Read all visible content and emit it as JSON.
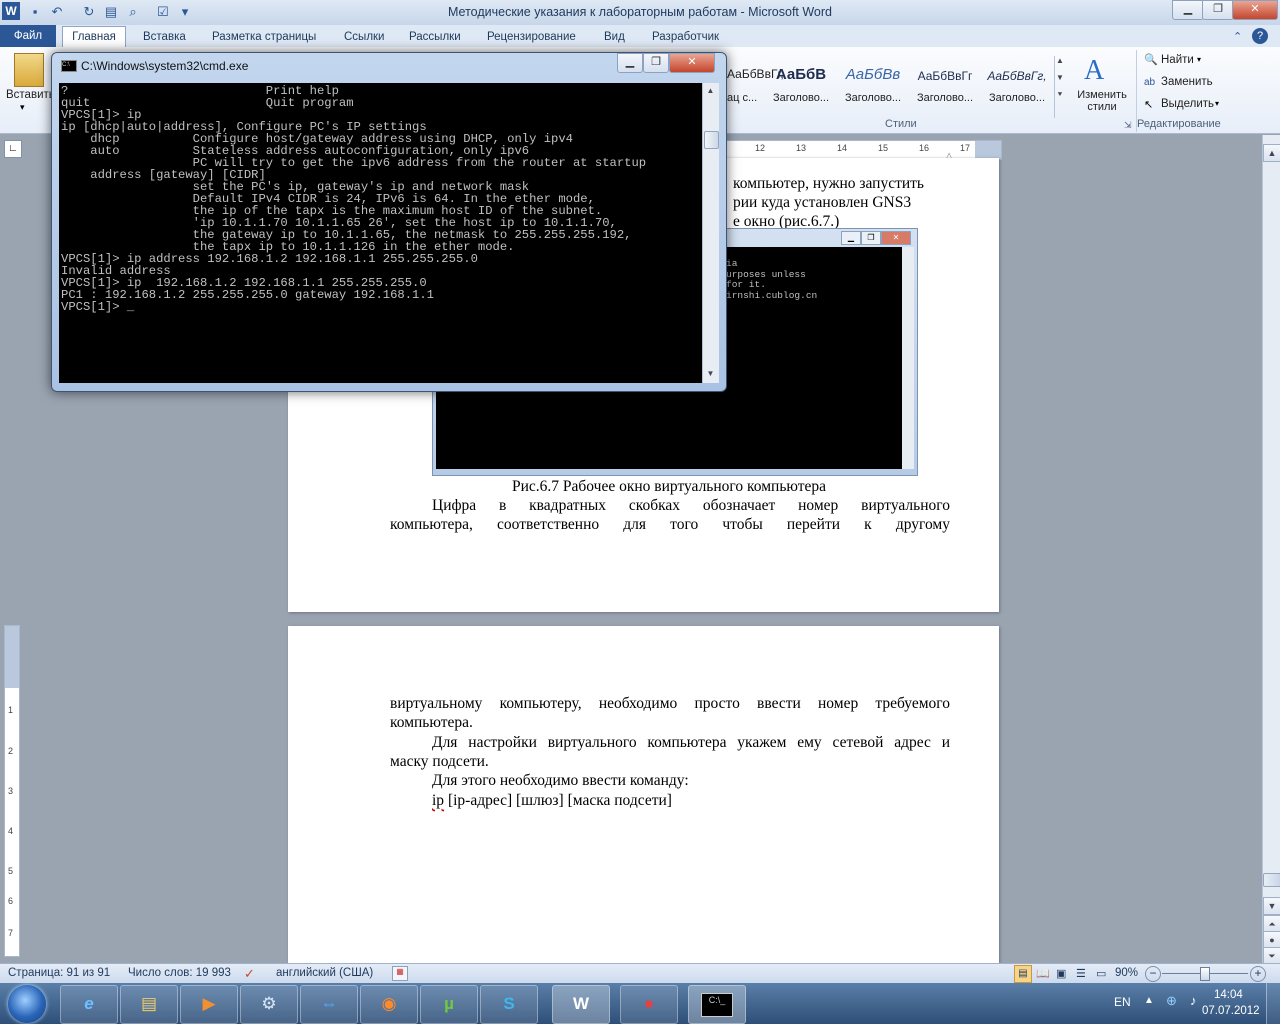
{
  "word": {
    "window_title": "Методические указания к лабораторным работам  -  Microsoft Word",
    "tabs": [
      "Файл",
      "Главная",
      "Вставка",
      "Разметка страницы",
      "Ссылки",
      "Рассылки",
      "Рецензирование",
      "Вид",
      "Разработчик"
    ],
    "ribbon": {
      "paste_label": "Вставить",
      "styles": [
        {
          "sample": "АаБбВвГг,",
          "label": "Заголово..."
        },
        {
          "sample": "АаБбВ",
          "label": "Заголово..."
        },
        {
          "sample": "АаБбВв",
          "label": "Заголово..."
        },
        {
          "sample": "АаБбВвГг",
          "label": "Заголово..."
        },
        {
          "sample": "АаБбВвГг,",
          "label": "Заголово..."
        }
      ],
      "hidden_style_label": "ац с...",
      "change_styles_label": "Изменить стили",
      "styles_group_label": "Стили",
      "find_label": "Найти",
      "replace_label": "Заменить",
      "select_label": "Выделить",
      "editing_group_label": "Редактирование"
    },
    "ruler_marks": [
      "12",
      "13",
      "14",
      "15",
      "16",
      "17"
    ],
    "vruler_marks": [
      "1",
      "2",
      "3",
      "4",
      "5",
      "6",
      "7"
    ],
    "page1": {
      "line1": "компьютер, нужно запустить",
      "line2": "рии куда установлен GNS3",
      "line3": "е окно (рис.6.7.)",
      "caption": "Рис.6.7 Рабочее окно виртуального компьютера",
      "para_l1": "Цифра в квадратных скобках обозначает номер виртуального",
      "para_l2": "компьютера, соответственно для того чтобы перейти к другому"
    },
    "page2": {
      "p1_l1": "виртуальному компьютеру, необходимо просто ввести номер требуемого",
      "p1_l2": "компьютера.",
      "p2_l1": "Для настройки виртуального компьютера укажем ему сетевой адрес и",
      "p2_l2": "маску подсети.",
      "p3": "Для этого необходимо ввести команду:",
      "cmd_ip": "ip",
      "cmd_rest": " [ip-адрес] [шлюз] [маска подсети]"
    },
    "statusbar": {
      "page": "Страница: 91 из 91",
      "words": "Число слов: 19 993",
      "language": "английский (США)",
      "zoom": "90%"
    }
  },
  "figure_console": {
    "lines": [
      "ia",
      "",
      "",
      "urposes unless",
      "for it.",
      "",
      "irnshi.cublog.cn"
    ]
  },
  "cmd": {
    "title": "C:\\Windows\\system32\\cmd.exe",
    "lines": [
      "?                           Print help",
      "quit                        Quit program",
      "",
      "VPCS[1]> ip",
      "",
      "ip [dhcp|auto|address], Configure PC's IP settings",
      "    dhcp          Configure host/gateway address using DHCP, only ipv4",
      "    auto          Stateless address autoconfiguration, only ipv6",
      "                  PC will try to get the ipv6 address from the router at startup",
      "    address [gateway] [CIDR]",
      "                  set the PC's ip, gateway's ip and network mask",
      "                  Default IPv4 CIDR is 24, IPv6 is 64. In the ether mode,",
      "                  the ip of the tapx is the maximum host ID of the subnet.",
      "",
      "                  'ip 10.1.1.70 10.1.1.65 26', set the host ip to 10.1.1.70,",
      "                  the gateway ip to 10.1.1.65, the netmask to 255.255.255.192,",
      "                  the tapx ip to 10.1.1.126 in the ether mode.",
      "",
      "VPCS[1]> ip address 192.168.1.2 192.168.1.1 255.255.255.0",
      "Invalid address",
      "",
      "VPCS[1]> ip  192.168.1.2 192.168.1.1 255.255.255.0",
      "PC1 : 192.168.1.2 255.255.255.0 gateway 192.168.1.1",
      "",
      "VPCS[1]> _"
    ]
  },
  "tray": {
    "lang": "EN",
    "time": "14:04",
    "date": "07.07.2012"
  }
}
